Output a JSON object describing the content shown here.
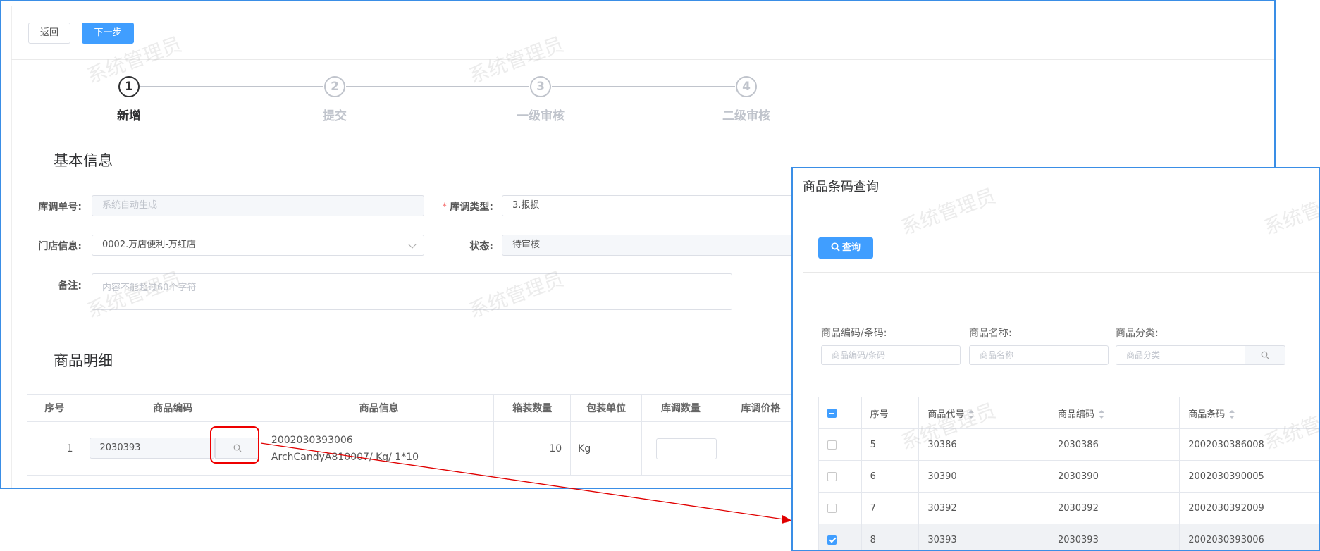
{
  "toolbar": {
    "back_label": "返回",
    "next_label": "下一步"
  },
  "steps": [
    {
      "number": "1",
      "title": "新增"
    },
    {
      "number": "2",
      "title": "提交"
    },
    {
      "number": "3",
      "title": "一级审核"
    },
    {
      "number": "4",
      "title": "二级审核"
    }
  ],
  "basic_info": {
    "title": "基本信息",
    "order_no_label": "库调单号:",
    "order_no_placeholder": "系统自动生成",
    "type_label": "库调类型:",
    "type_required_mark": "*",
    "type_value": "3.报损",
    "store_label": "门店信息:",
    "store_value": "0002.万店便利-万红店",
    "status_label": "状态:",
    "status_value": "待审核",
    "remark_label": "备注:",
    "remark_placeholder": "内容不能超过60个字符"
  },
  "product_detail": {
    "title": "商品明细",
    "columns": [
      "序号",
      "商品编码",
      "商品信息",
      "箱装数量",
      "包装单位",
      "库调数量",
      "库调价格"
    ],
    "row": {
      "index": "1",
      "code": "2030393",
      "info_line1": "2002030393006",
      "info_line2": "ArchCandyA810007/ Kg/ 1*10",
      "box_qty": "10",
      "unit": "Kg"
    }
  },
  "dialog": {
    "title": "商品条码查询",
    "query_label": "查询",
    "filter_code_label": "商品编码/条码:",
    "filter_code_placeholder": "商品编码/条码",
    "filter_name_label": "商品名称:",
    "filter_name_placeholder": "商品名称",
    "filter_cat_label": "商品分类:",
    "filter_cat_placeholder": "商品分类",
    "columns": [
      "序号",
      "商品代号",
      "商品编码",
      "商品条码"
    ],
    "rows": [
      {
        "index": "5",
        "product_no": "30386",
        "code": "2030386",
        "barcode": "2002030386008",
        "checked": false
      },
      {
        "index": "6",
        "product_no": "30390",
        "code": "2030390",
        "barcode": "2002030390005",
        "checked": false
      },
      {
        "index": "7",
        "product_no": "30392",
        "code": "2030392",
        "barcode": "2002030392009",
        "checked": false
      },
      {
        "index": "8",
        "product_no": "30393",
        "code": "2030393",
        "barcode": "2002030393006",
        "checked": true
      }
    ]
  },
  "watermark": "系统管理员",
  "colors": {
    "primary": "#409eff",
    "frame": "#3a8ee6",
    "arrow": "#e00000"
  }
}
